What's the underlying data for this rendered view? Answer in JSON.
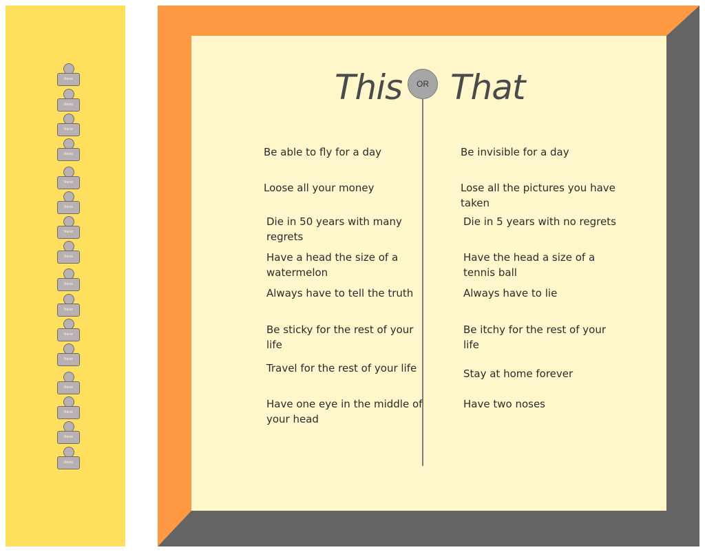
{
  "title": {
    "left": "This",
    "connector": "OR",
    "right": "That"
  },
  "avatar_label": "Name",
  "avatar_count": 16,
  "colors": {
    "sidebar": "#ffdf5e",
    "frame_top_left": "#ff9944",
    "frame_bottom_right": "#646464",
    "panel": "#fff6cc",
    "avatar_fill": "#b9b1b1"
  },
  "options": [
    {
      "this": "Be able to fly for a day",
      "that": "Be invisible for a day"
    },
    {
      "this": "Loose all your money",
      "that": "Lose all the pictures you have taken"
    },
    {
      "this": "Die in 50 years with many regrets",
      "that": "Die in 5 years with no regrets"
    },
    {
      "this": "Have a head the size of a watermelon",
      "that": "Have the head a size of a tennis ball"
    },
    {
      "this": "Always have to tell the truth",
      "that": "Always have to lie"
    },
    {
      "this": "Be sticky for the rest of your life",
      "that": "Be itchy for the rest of your life"
    },
    {
      "this": "Travel  for the rest of your life",
      "that": "Stay at home forever"
    },
    {
      "this": "Have one eye in the middle of your head",
      "that": "Have two noses"
    }
  ]
}
